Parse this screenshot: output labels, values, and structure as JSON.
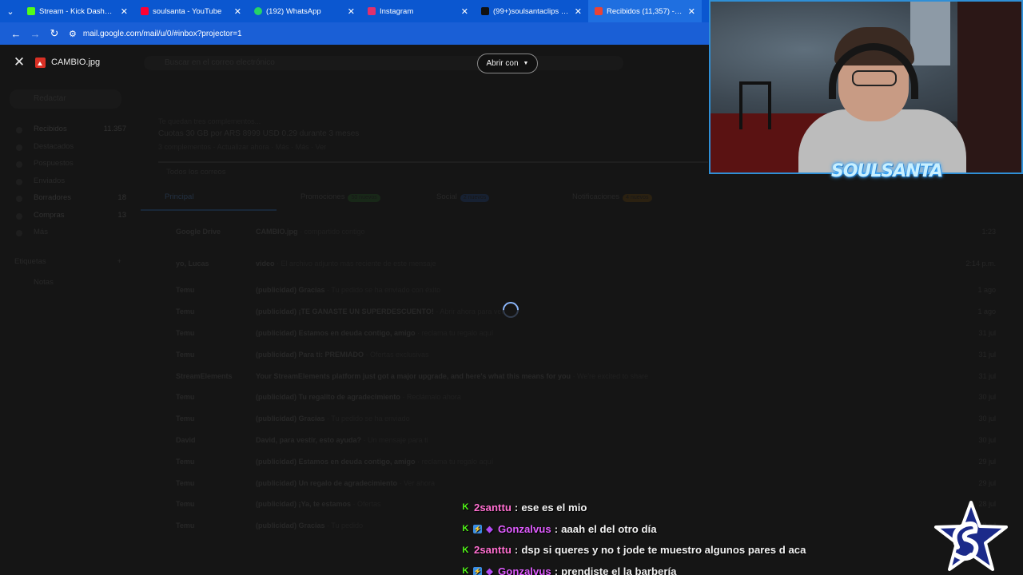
{
  "browser": {
    "tabs": [
      {
        "label": "Stream - Kick Dashboard",
        "color": "#53fc18"
      },
      {
        "label": "soulsanta - YouTube",
        "color": "#ff0033"
      },
      {
        "label": "(192) WhatsApp",
        "color": "#25d366"
      },
      {
        "label": "Instagram",
        "color": "#e1306c"
      },
      {
        "label": "(99+)soulsantaclips (@sou",
        "color": "#111111"
      },
      {
        "label": "Recibidos (11,357) - esteb",
        "color": "#ea4335"
      }
    ],
    "url": "mail.google.com/mail/u/0/#inbox?projector=1"
  },
  "gmail": {
    "search_placeholder": "Buscar en el correo electrónico",
    "compose": "Redactar",
    "sidebar": [
      {
        "label": "Recibidos",
        "count": "11.357"
      },
      {
        "label": "Destacados",
        "count": ""
      },
      {
        "label": "Pospuestos",
        "count": ""
      },
      {
        "label": "Enviados",
        "count": ""
      },
      {
        "label": "Borradores",
        "count": "18"
      },
      {
        "label": "Compras",
        "count": "13"
      },
      {
        "label": "Más",
        "count": ""
      }
    ],
    "labels_title": "Etiquetas",
    "labels_add": "+",
    "label1": "Notas",
    "promo_sponsor": "Te quedan tres complementos...",
    "promo_title": "Cuotas 30 GB por ARS 8999 USD 0.29 durante 3 meses",
    "promo_sub": "3 complementos · Actualizar ahora · Más · Más · Ver",
    "filter": "Todos los correos",
    "tabs": [
      {
        "label": "Principal",
        "chip": ""
      },
      {
        "label": "Promociones",
        "chip": "50 nuevos"
      },
      {
        "label": "Social",
        "chip": "2 nuevos"
      },
      {
        "label": "Notificaciones",
        "chip": "4 nuevos"
      }
    ],
    "rows": [
      {
        "sender": "Google Drive",
        "subject": "CAMBIO.jpg",
        "snippet": " · compartido contigo",
        "date": "1:23"
      },
      {
        "sender": "yo, Lucas",
        "subject": "video",
        "snippet": " · El archivo adjunto más reciente de este mensaje",
        "date": "2:14 p.m."
      },
      {
        "sender": "Temu",
        "subject": "(publicidad) Gracias",
        "snippet": " · Tu pedido se ha enviado con éxito",
        "date": "1 ago"
      },
      {
        "sender": "Temu",
        "subject": "(publicidad) ¡TE GANASTE UN SUPERDESCUENTO!",
        "snippet": " · Abrir ahora para ver",
        "date": "1 ago"
      },
      {
        "sender": "Temu",
        "subject": "(publicidad) Estamos en deuda contigo, amigo",
        "snippet": " · reclama tu regalo aquí",
        "date": "31 jul"
      },
      {
        "sender": "Temu",
        "subject": "(publicidad) Para ti: PREMIADO",
        "snippet": " · Ofertas exclusivas",
        "date": "31 jul"
      },
      {
        "sender": "StreamElements",
        "subject": "Your StreamElements platform just got a major upgrade, and here's what this means for you",
        "snippet": " · We're excited to share",
        "date": "31 jul"
      },
      {
        "sender": "Temu",
        "subject": "(publicidad) Tu regalito de agradecimiento",
        "snippet": " · Reclámalo ahora",
        "date": "30 jul"
      },
      {
        "sender": "Temu",
        "subject": "(publicidad) Gracias",
        "snippet": " · Tu pedido se ha enviado",
        "date": "30 jul"
      },
      {
        "sender": "David",
        "subject": "David, para vestir, esto ayuda?",
        "snippet": " · Un mensaje para ti",
        "date": "30 jul"
      },
      {
        "sender": "Temu",
        "subject": "(publicidad) Estamos en deuda contigo, amigo",
        "snippet": " · reclama tu regalo aquí",
        "date": "29 jul"
      },
      {
        "sender": "Temu",
        "subject": "(publicidad) Un regalo de agradecimiento",
        "snippet": " · Ver ahora",
        "date": "29 jul"
      },
      {
        "sender": "Temu",
        "subject": "(publicidad) ¡Ya, te estamos",
        "snippet": " · Ofertas",
        "date": "28 jul"
      },
      {
        "sender": "Temu",
        "subject": "(publicidad) Gracias",
        "snippet": " · Tu pedido",
        "date": "28 jul"
      }
    ]
  },
  "viewer": {
    "file_name": "CAMBIO.jpg",
    "open_with": "Abrir con"
  },
  "overlay": {
    "streamer_name": "SOULSANTA"
  },
  "chat": [
    {
      "user": "2santtu",
      "user_color": "#ff6fd0",
      "badges": [
        "kick"
      ],
      "text": "ese es el mio"
    },
    {
      "user": "Gonzalvus",
      "user_color": "#e05cff",
      "badges": [
        "kick",
        "blue",
        "gem"
      ],
      "text": "aaah el del otro día"
    },
    {
      "user": "2santtu",
      "user_color": "#ff6fd0",
      "badges": [
        "kick"
      ],
      "text": "dsp si queres y no t jode te muestro algunos pares d aca"
    },
    {
      "user": "Gonzalvus",
      "user_color": "#e05cff",
      "badges": [
        "kick",
        "blue",
        "gem"
      ],
      "text": "prendiste el la barbería"
    }
  ]
}
